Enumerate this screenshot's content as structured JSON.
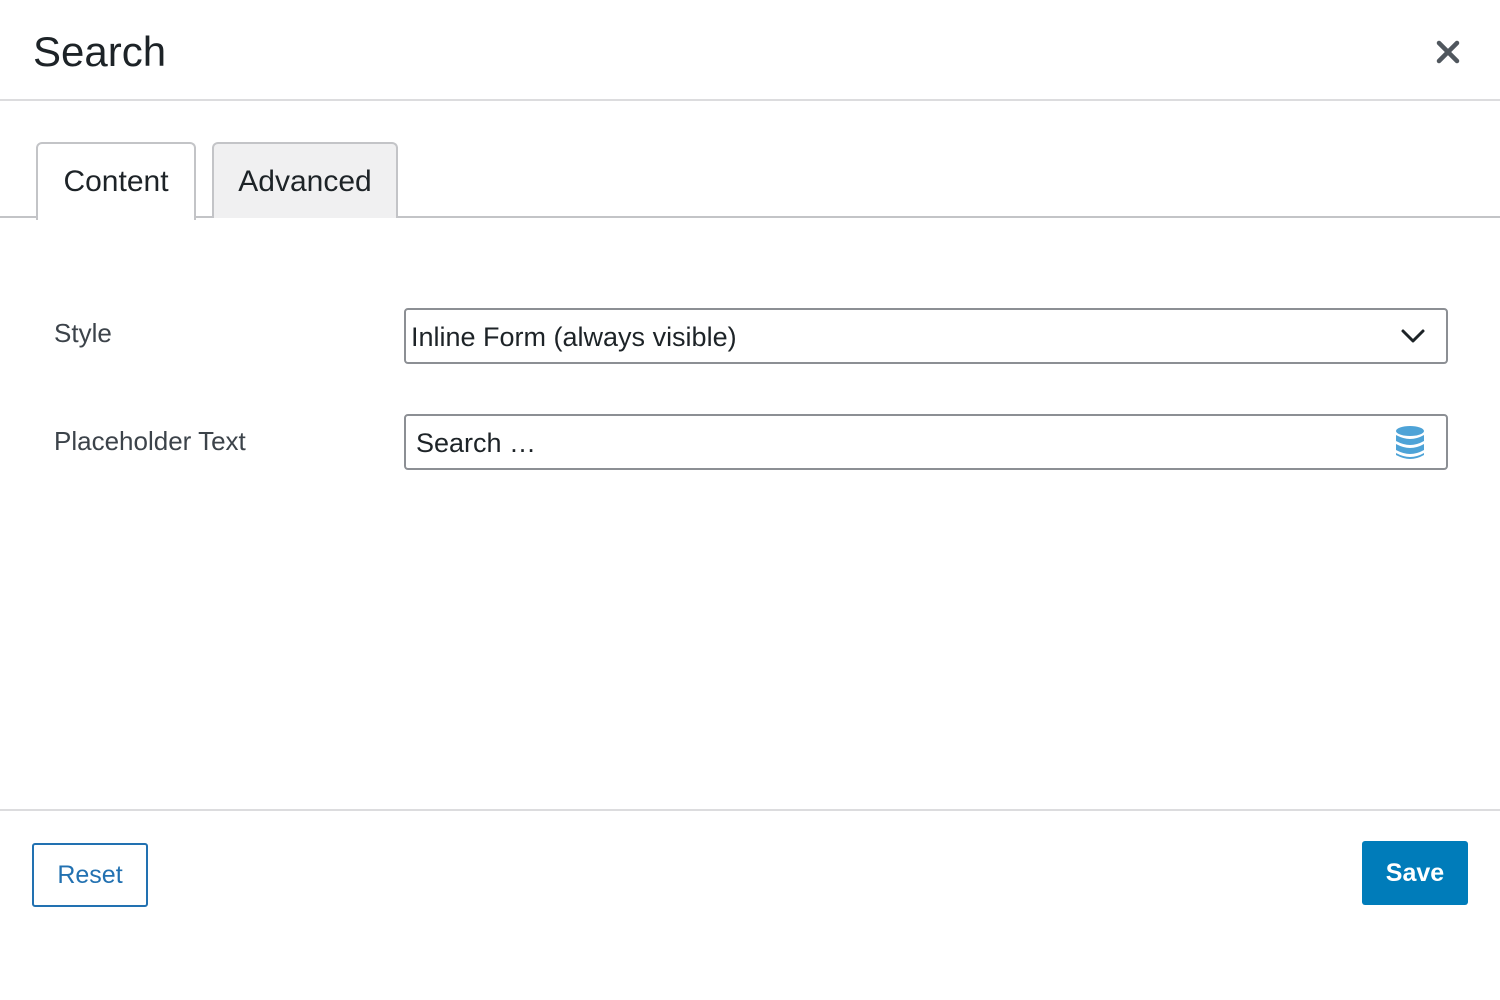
{
  "modal": {
    "title": "Search",
    "close_icon": "close-icon"
  },
  "tabs": [
    {
      "label": "Content",
      "active": true
    },
    {
      "label": "Advanced",
      "active": false
    }
  ],
  "form": {
    "style": {
      "label": "Style",
      "selected": "Inline Form (always visible)",
      "icon": "chevron-down-icon"
    },
    "placeholder_text": {
      "label": "Placeholder Text",
      "value": "Search …",
      "icon": "database-icon"
    }
  },
  "footer": {
    "reset_label": "Reset",
    "save_label": "Save"
  },
  "colors": {
    "primary": "#007cba",
    "link": "#2271b1",
    "text": "#1d2327",
    "label_text": "#3c434a",
    "border": "#8c8f94",
    "inactive_tab_bg": "#f0f0f1",
    "db_icon": "#4ea3d7"
  }
}
